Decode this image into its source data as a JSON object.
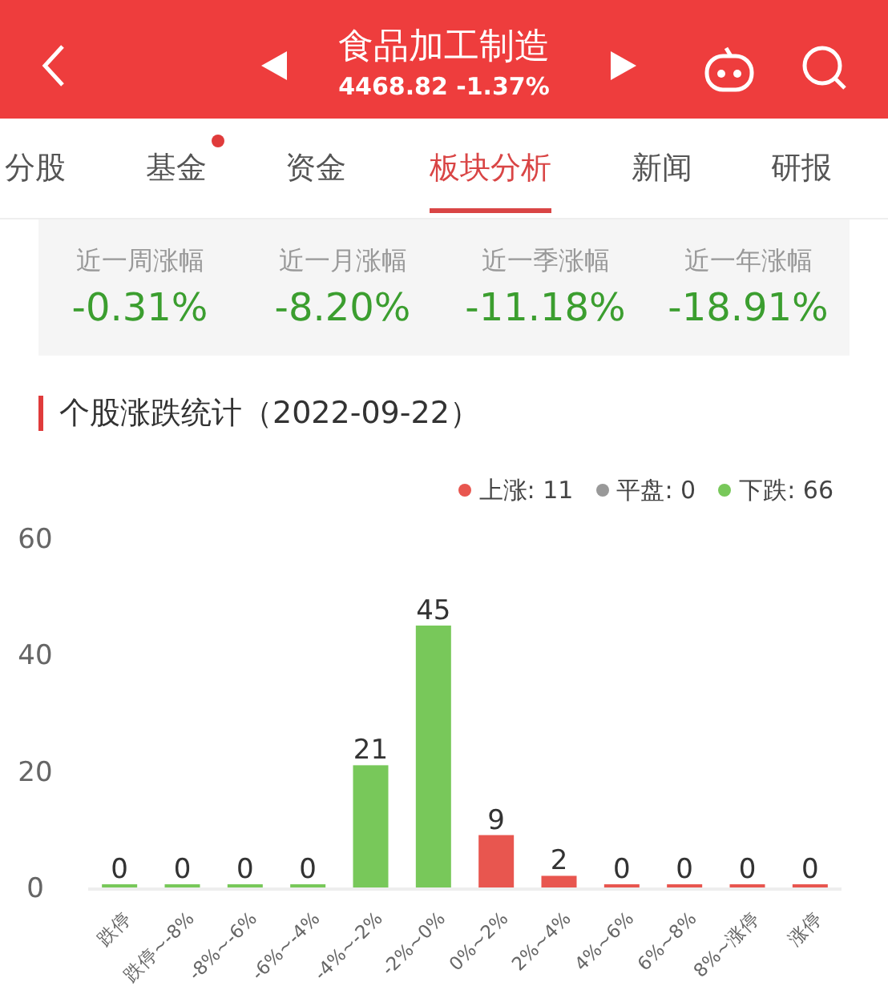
{
  "header": {
    "title": "食品加工制造",
    "subtitle": "4468.82 -1.37%"
  },
  "tabs": [
    {
      "label": "分股",
      "selected": false,
      "dot": false
    },
    {
      "label": "基金",
      "selected": false,
      "dot": true
    },
    {
      "label": "资金",
      "selected": false,
      "dot": false
    },
    {
      "label": "板块分析",
      "selected": true,
      "dot": false
    },
    {
      "label": "新闻",
      "selected": false,
      "dot": false
    },
    {
      "label": "研报",
      "selected": false,
      "dot": false
    }
  ],
  "stats": [
    {
      "label": "近一周涨幅",
      "value": "-0.31%"
    },
    {
      "label": "近一月涨幅",
      "value": "-8.20%"
    },
    {
      "label": "近一季涨幅",
      "value": "-11.18%"
    },
    {
      "label": "近一年涨幅",
      "value": "-18.91%"
    }
  ],
  "section_title": "个股涨跌统计（2022-09-22）",
  "legend": [
    {
      "label": "上涨: 11",
      "color": "#e8564f"
    },
    {
      "label": "平盘: 0",
      "color": "#999999"
    },
    {
      "label": "下跌: 66",
      "color": "#78c85a"
    }
  ],
  "chart_data": {
    "type": "bar",
    "categories": [
      "跌停",
      "跌停~-8%",
      "-8%~-6%",
      "-6%~-4%",
      "-4%~-2%",
      "-2%~0%",
      "0%~2%",
      "2%~4%",
      "4%~6%",
      "6%~8%",
      "8%~涨停",
      "涨停"
    ],
    "series": [
      {
        "color": "#78c85a",
        "values": [
          0,
          0,
          0,
          0,
          21,
          45,
          null,
          null,
          null,
          null,
          null,
          null
        ]
      },
      {
        "color": "#e8564f",
        "values": [
          null,
          null,
          null,
          null,
          null,
          null,
          9,
          2,
          0,
          0,
          0,
          0
        ]
      }
    ],
    "ylim": [
      0,
      60
    ],
    "yticks": [
      0,
      20,
      40,
      60
    ],
    "data_labels": true
  }
}
